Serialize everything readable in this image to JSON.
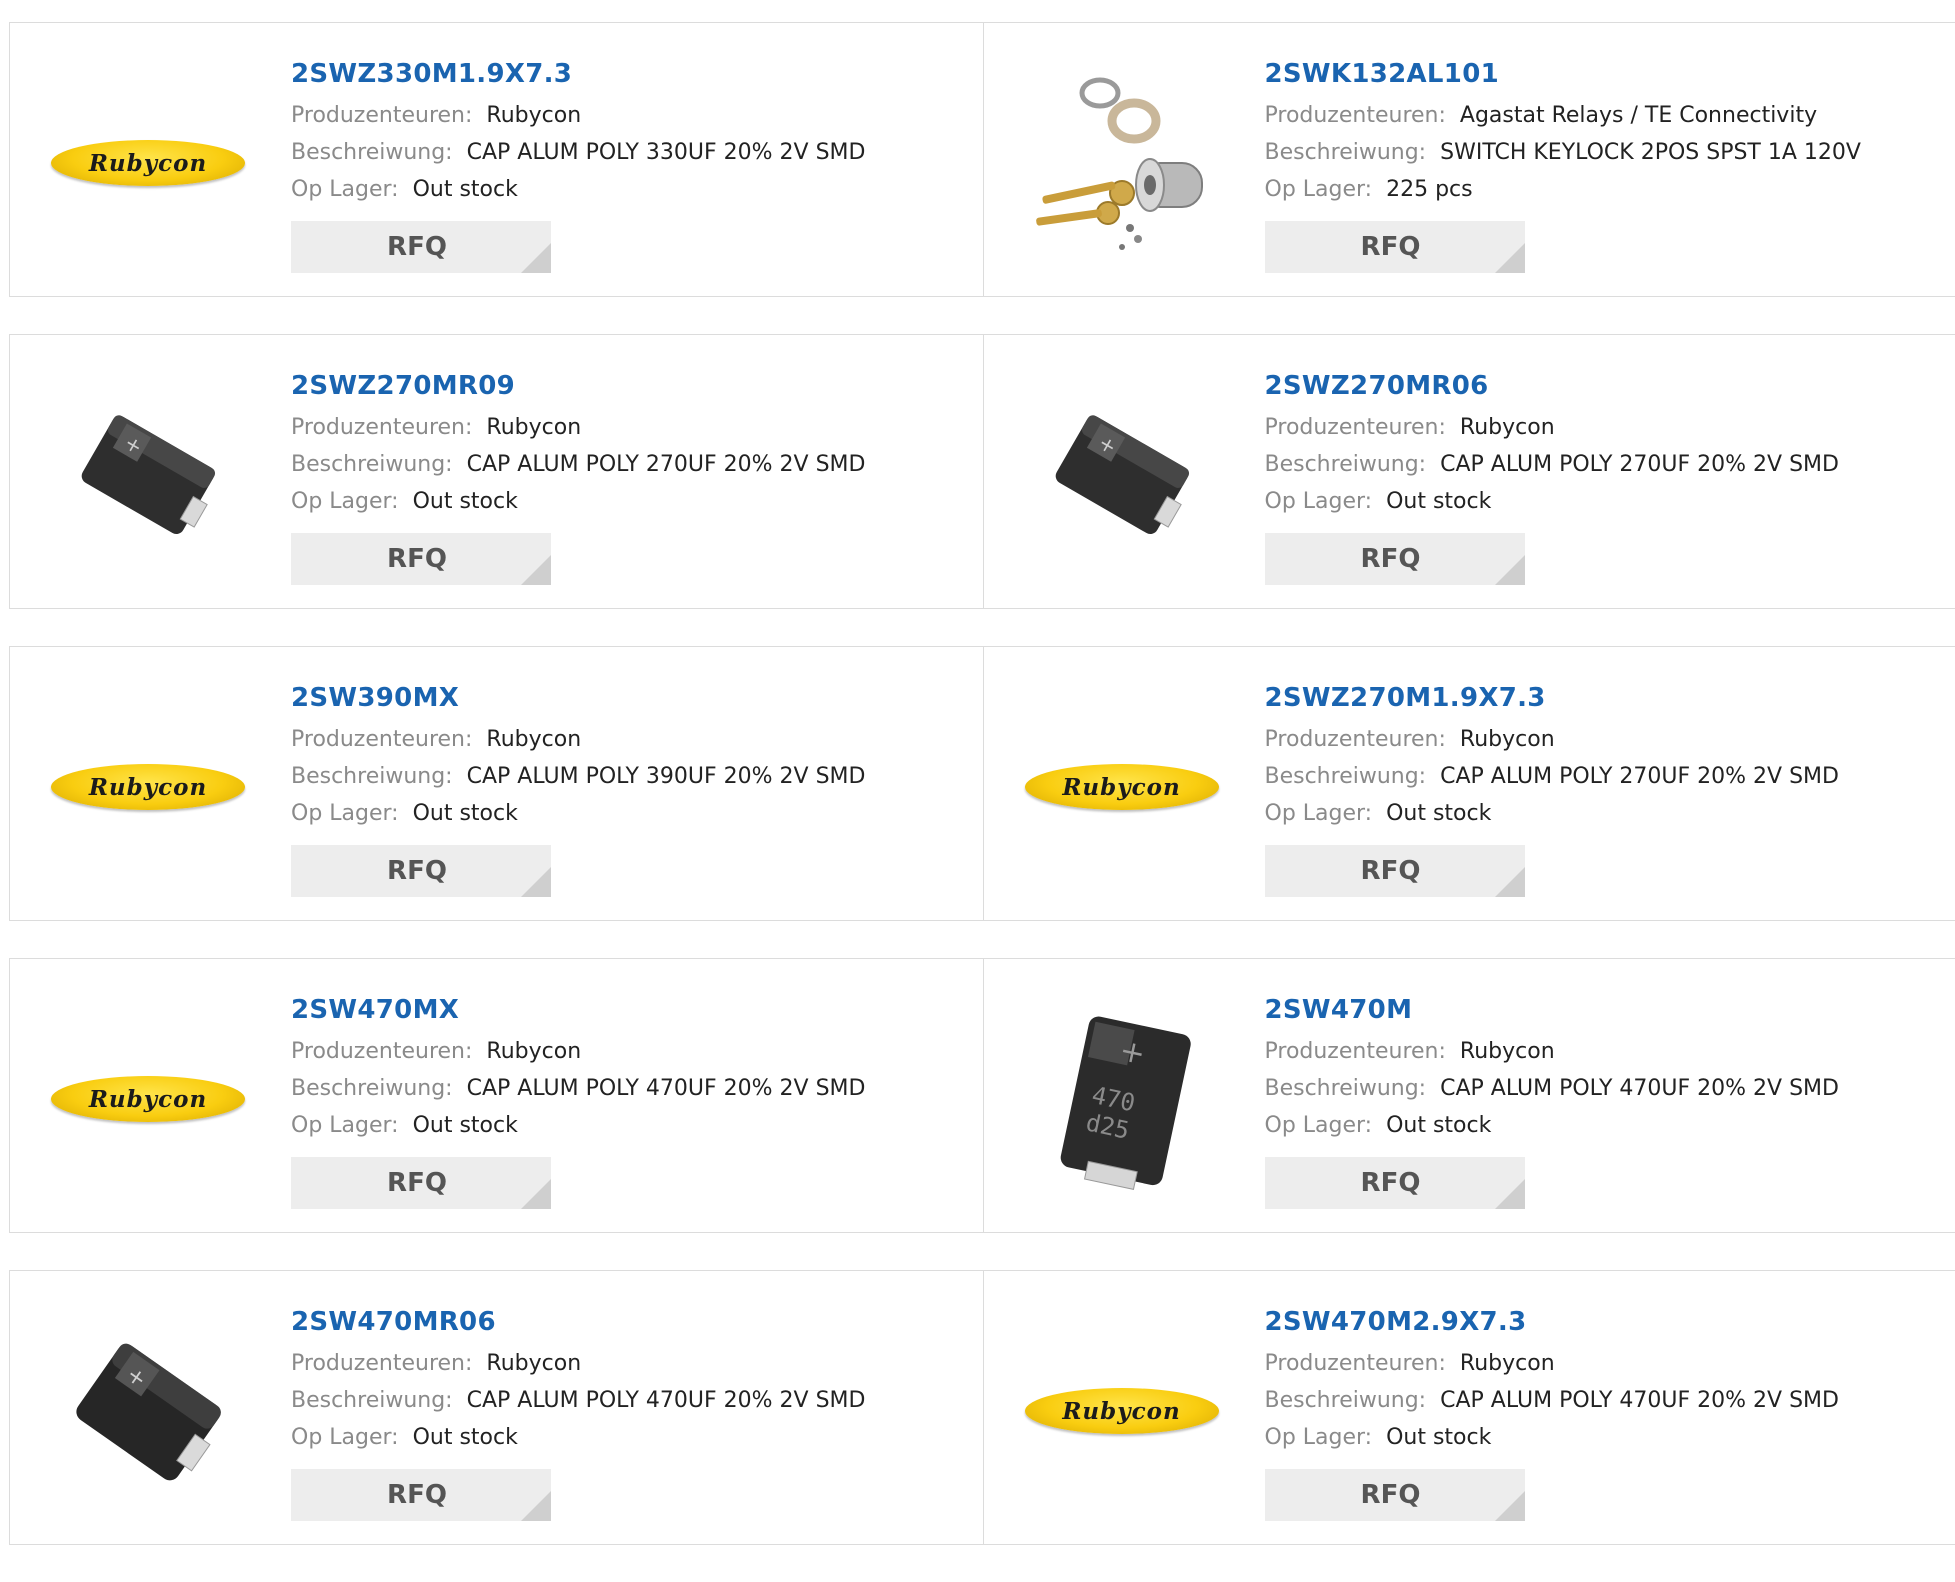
{
  "labels": {
    "manufacturer": "Produzenteuren:",
    "description": "Beschreiwung:",
    "stock": "Op Lager:",
    "rfq": "RFQ"
  },
  "logo_text": "Rubycon",
  "products": [
    {
      "part": "2SWZ330M1.9X7.3",
      "manufacturer": "Rubycon",
      "description": "CAP ALUM POLY 330UF 20% 2V SMD",
      "stock": "Out stock",
      "image": "rubycon-logo"
    },
    {
      "part": "2SWK132AL101",
      "manufacturer": "Agastat Relays / TE Connectivity",
      "description": "SWITCH KEYLOCK 2POS SPST 1A 120V",
      "stock": "225 pcs",
      "image": "keylock-switch"
    },
    {
      "part": "2SWZ270MR09",
      "manufacturer": "Rubycon",
      "description": "CAP ALUM POLY 270UF 20% 2V SMD",
      "stock": "Out stock",
      "image": "smd-capacitor"
    },
    {
      "part": "2SWZ270MR06",
      "manufacturer": "Rubycon",
      "description": "CAP ALUM POLY 270UF 20% 2V SMD",
      "stock": "Out stock",
      "image": "smd-capacitor"
    },
    {
      "part": "2SW390MX",
      "manufacturer": "Rubycon",
      "description": "CAP ALUM POLY 390UF 20% 2V SMD",
      "stock": "Out stock",
      "image": "rubycon-logo"
    },
    {
      "part": "2SWZ270M1.9X7.3",
      "manufacturer": "Rubycon",
      "description": "CAP ALUM POLY 270UF 20% 2V SMD",
      "stock": "Out stock",
      "image": "rubycon-logo"
    },
    {
      "part": "2SW470MX",
      "manufacturer": "Rubycon",
      "description": "CAP ALUM POLY 470UF 20% 2V SMD",
      "stock": "Out stock",
      "image": "rubycon-logo"
    },
    {
      "part": "2SW470M",
      "manufacturer": "Rubycon",
      "description": "CAP ALUM POLY 470UF 20% 2V SMD",
      "stock": "Out stock",
      "image": "smd-capacitor-marked",
      "marking": [
        "470",
        "d25"
      ]
    },
    {
      "part": "2SW470MR06",
      "manufacturer": "Rubycon",
      "description": "CAP ALUM POLY 470UF 20% 2V SMD",
      "stock": "Out stock",
      "image": "smd-capacitor"
    },
    {
      "part": "2SW470M2.9X7.3",
      "manufacturer": "Rubycon",
      "description": "CAP ALUM POLY 470UF 20% 2V SMD",
      "stock": "Out stock",
      "image": "rubycon-logo"
    }
  ]
}
